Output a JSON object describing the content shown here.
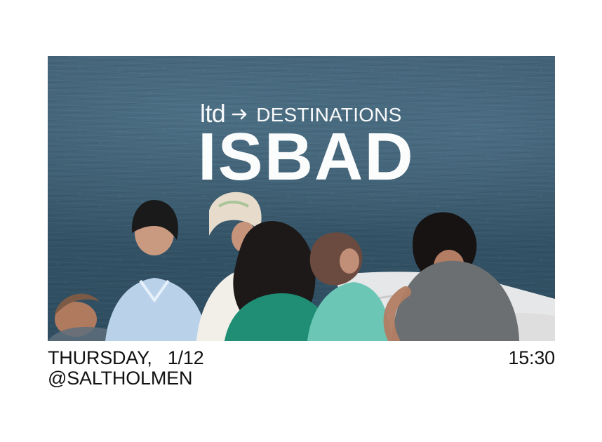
{
  "hero": {
    "brand_ltd": "ltd",
    "brand_destinations": "DESTINATIONS",
    "title": "ISBAD",
    "arrow_icon": "arrow-right-icon"
  },
  "details": {
    "day": "THURSDAY,",
    "date": "1/12",
    "location": "@SALTHOLMEN",
    "time": "15:30"
  },
  "colors": {
    "text_on_photo": "#ffffff",
    "text_dark": "#121212",
    "sea_dark": "#2f4d60",
    "sea_mid": "#365467",
    "sea_light": "#4c6f84"
  }
}
